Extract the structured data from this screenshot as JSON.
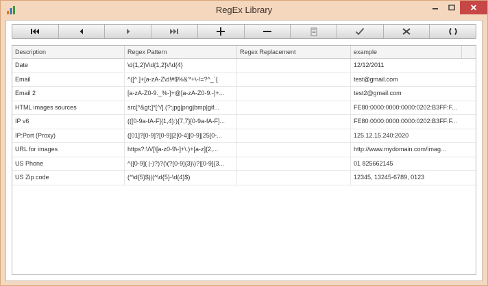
{
  "window": {
    "title": "RegEx Library"
  },
  "toolbar": {
    "buttons": [
      {
        "name": "first-record-button",
        "icon": "skip-first-icon"
      },
      {
        "name": "previous-record-button",
        "icon": "triangle-left-icon"
      },
      {
        "name": "next-record-button",
        "icon": "triangle-right-icon"
      },
      {
        "name": "last-record-button",
        "icon": "skip-last-icon"
      },
      {
        "name": "add-record-button",
        "icon": "plus-icon"
      },
      {
        "name": "delete-record-button",
        "icon": "minus-icon"
      },
      {
        "name": "edit-record-button",
        "icon": "document-icon"
      },
      {
        "name": "confirm-edit-button",
        "icon": "checkmark-icon"
      },
      {
        "name": "cancel-edit-button",
        "icon": "cross-icon"
      },
      {
        "name": "refresh-button",
        "icon": "refresh-icon"
      }
    ]
  },
  "table": {
    "columns": [
      "Description",
      "Regex Pattern",
      "Regex Replacement",
      "example"
    ],
    "rows": [
      [
        "Date",
        "\\d{1,2}\\/\\d{1,2}\\/\\d{4}",
        "",
        "12/12/2011"
      ],
      [
        "Email",
        "^([^.]+[a-zA-Z\\d!#$%&'*+\\-/=?^_`{",
        "",
        "test@gmail.com"
      ],
      [
        "Email 2",
        "[a-zA-Z0-9._%-]+@[a-zA-Z0-9.-]+...",
        "",
        "test2@gmail.com"
      ],
      [
        "HTML images sources",
        "src[^&gt;]*[^/].(?:jpg|png|bmp|gif...",
        "",
        "FE80:0000:0000:0000:0202:B3FF:F..."
      ],
      [
        "IP v6",
        "(([0-9a-fA-F]{1,4}:){7,7}[0-9a-fA-F]...",
        "",
        "FE80:0000:0000:0000:0202:B3FF:F..."
      ],
      [
        "IP:Port (Proxy)",
        "([01]?[0-9]?[0-9]|2[0-4][0-9]|25[0-...",
        "",
        "125.12.15.240:2020"
      ],
      [
        "URL for images",
        "https?:\\/\\/[\\[a-z0-9\\-]+\\.)+[a-z]{2,...",
        "",
        "http://www.mydomain.com/imag..."
      ],
      [
        "US Phone",
        "^([0-9]( |-)?)?(\\(?[0-9]{3}\\)?|[0-9]{3...",
        "",
        "01 825662145"
      ],
      [
        "US Zip code",
        "(^\\d{5}$)|(^\\d{5}-\\d{4}$)",
        "",
        "12345, 13245-6789, 0123"
      ]
    ]
  }
}
